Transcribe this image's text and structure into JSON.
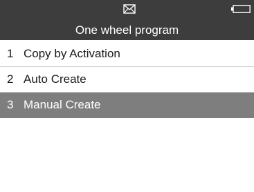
{
  "header": {
    "title": "One wheel program",
    "icons": [
      "mail-icon",
      "battery-icon"
    ]
  },
  "menu": {
    "items": [
      {
        "number": "1",
        "label": "Copy by Activation",
        "selected": false
      },
      {
        "number": "2",
        "label": "Auto Create",
        "selected": false
      },
      {
        "number": "3",
        "label": "Manual Create",
        "selected": true
      }
    ]
  },
  "colors": {
    "header_bg": "#3d3d3d",
    "selected_bg": "#7e7e7e",
    "background": "#ffffff"
  }
}
